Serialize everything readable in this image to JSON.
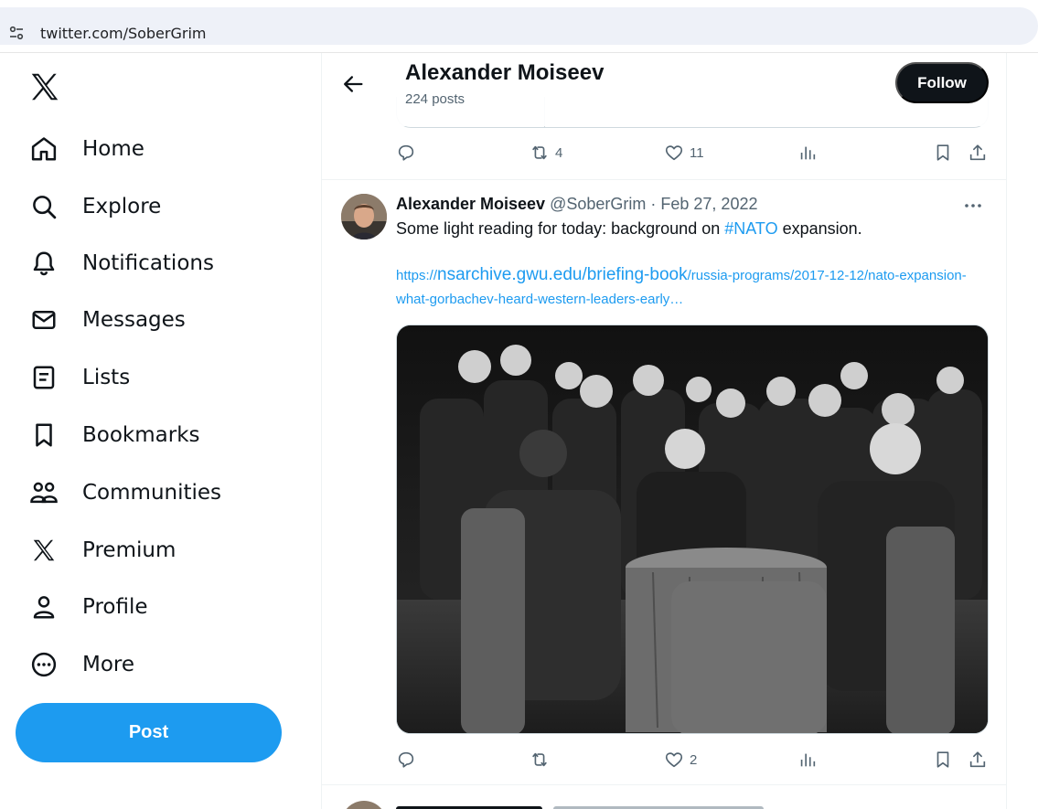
{
  "browser": {
    "url": "twitter.com/SoberGrim"
  },
  "sidebar": {
    "items": [
      {
        "label": "Home",
        "icon": "home-icon"
      },
      {
        "label": "Explore",
        "icon": "search-icon"
      },
      {
        "label": "Notifications",
        "icon": "bell-icon"
      },
      {
        "label": "Messages",
        "icon": "mail-icon"
      },
      {
        "label": "Lists",
        "icon": "list-icon"
      },
      {
        "label": "Bookmarks",
        "icon": "bookmark-icon"
      },
      {
        "label": "Communities",
        "icon": "communities-icon"
      },
      {
        "label": "Premium",
        "icon": "x-logo-icon"
      },
      {
        "label": "Profile",
        "icon": "person-icon"
      },
      {
        "label": "More",
        "icon": "more-circle-icon"
      }
    ],
    "post_label": "Post"
  },
  "header": {
    "name": "Alexander Moiseev",
    "post_count": "224 posts",
    "follow_label": "Follow"
  },
  "prev_tweet_actions": {
    "retweets": "4",
    "likes": "11"
  },
  "tweet": {
    "author": "Alexander Moiseev",
    "handle": "@SoberGrim",
    "dot": " · ",
    "date": "Feb 27, 2022",
    "text_before": "Some light reading for today: background on ",
    "hashtag": "#NATO",
    "text_after": " expansion.",
    "link_prefix": "https://",
    "link_domain": "nsarchive.gwu.edu/briefing-book",
    "link_rest": "/russia-programs/2017-12-12/nato-expansion-what-gorbachev-heard-western-leaders-early…",
    "likes": "2"
  },
  "colors": {
    "accent": "#1d9bf0",
    "text": "#0f1419",
    "muted": "#536471"
  }
}
